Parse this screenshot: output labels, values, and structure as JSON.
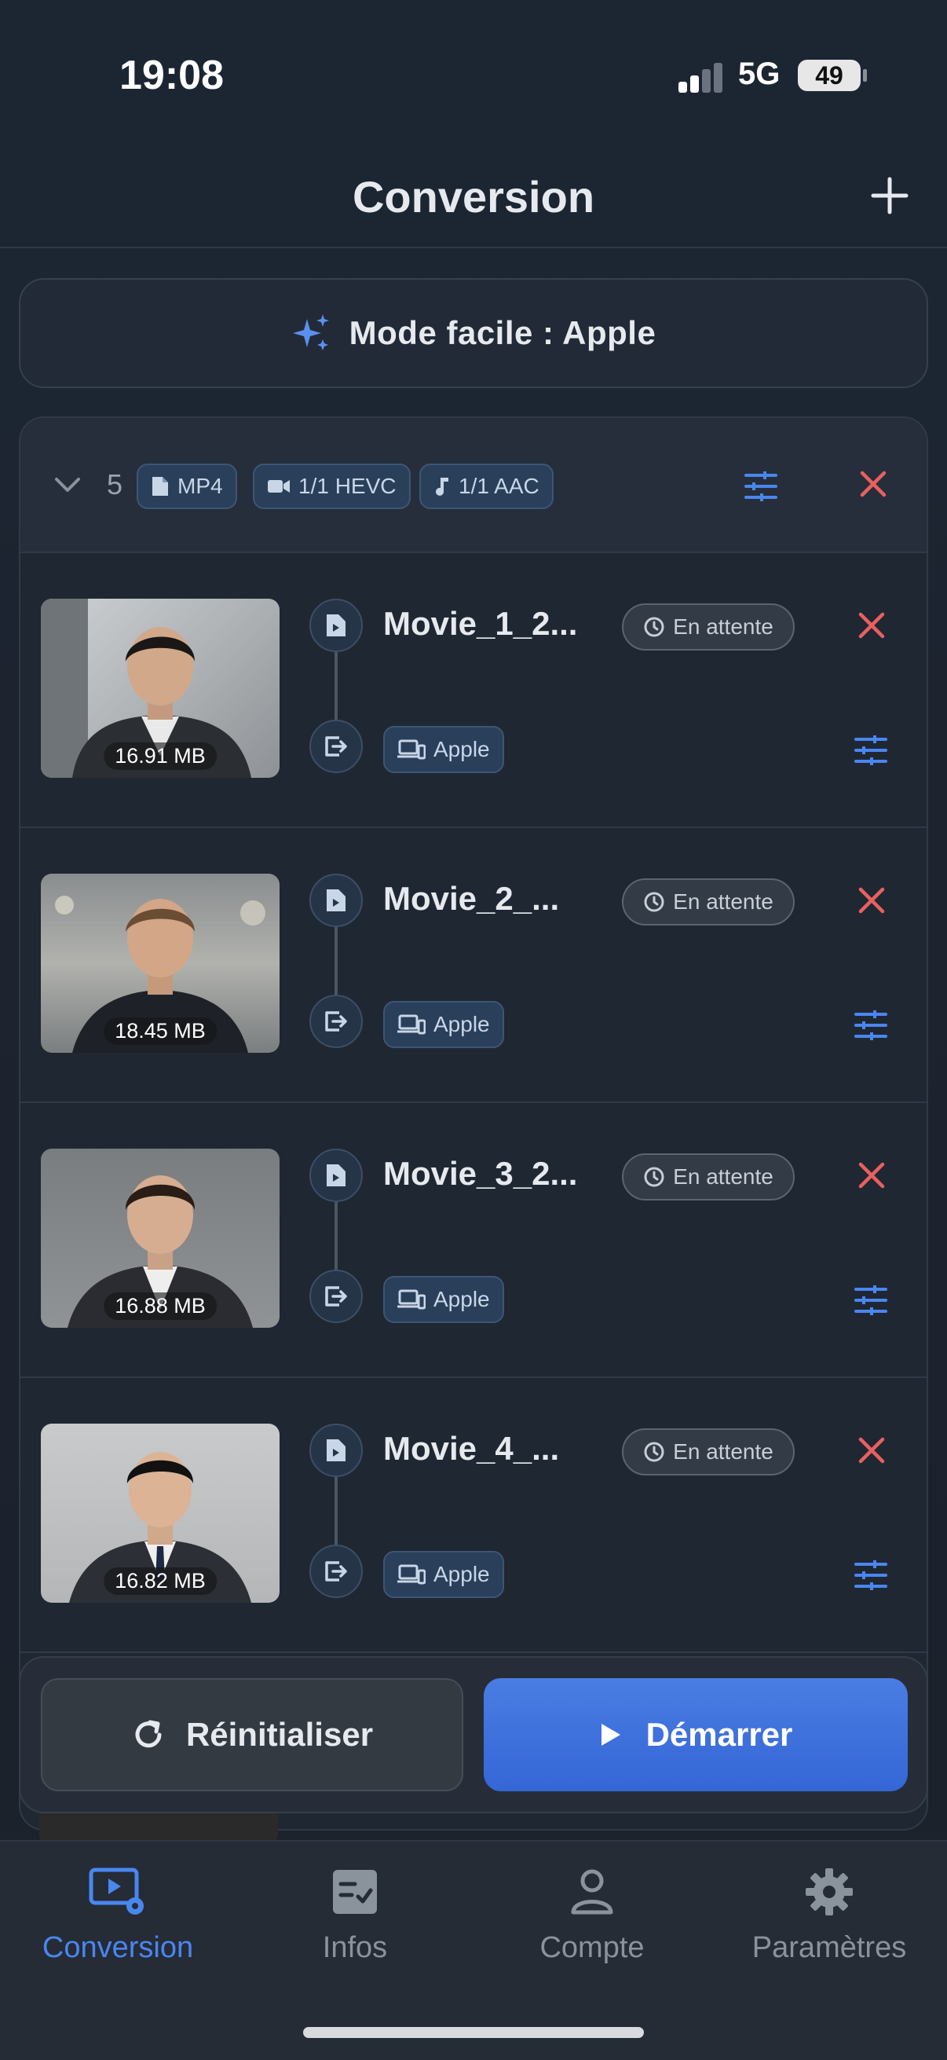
{
  "status_bar": {
    "time": "19:08",
    "network": "5G",
    "battery": "49"
  },
  "header": {
    "title": "Conversion"
  },
  "easy_mode": {
    "label": "Mode facile : Apple"
  },
  "group": {
    "count": "5",
    "chips": [
      "MP4",
      "1/1 HEVC",
      "1/1 AAC"
    ]
  },
  "items": [
    {
      "name": "Movie_1_2...",
      "size": "16.91 MB",
      "status": "En attente",
      "target": "Apple"
    },
    {
      "name": "Movie_2_...",
      "size": "18.45 MB",
      "status": "En attente",
      "target": "Apple"
    },
    {
      "name": "Movie_3_2...",
      "size": "16.88 MB",
      "status": "En attente",
      "target": "Apple"
    },
    {
      "name": "Movie_4_...",
      "size": "16.82 MB",
      "status": "En attente",
      "target": "Apple"
    }
  ],
  "actions": {
    "reset": "Réinitialiser",
    "start": "Démarrer"
  },
  "tabs": [
    {
      "label": "Conversion",
      "icon": "video-settings-icon",
      "active": true
    },
    {
      "label": "Infos",
      "icon": "checklist-icon",
      "active": false
    },
    {
      "label": "Compte",
      "icon": "person-icon",
      "active": false
    },
    {
      "label": "Paramètres",
      "icon": "gear-icon",
      "active": false
    }
  ],
  "colors": {
    "accent": "#4a86f0",
    "danger": "#e86060",
    "primary_button": "#3a6ddc"
  }
}
